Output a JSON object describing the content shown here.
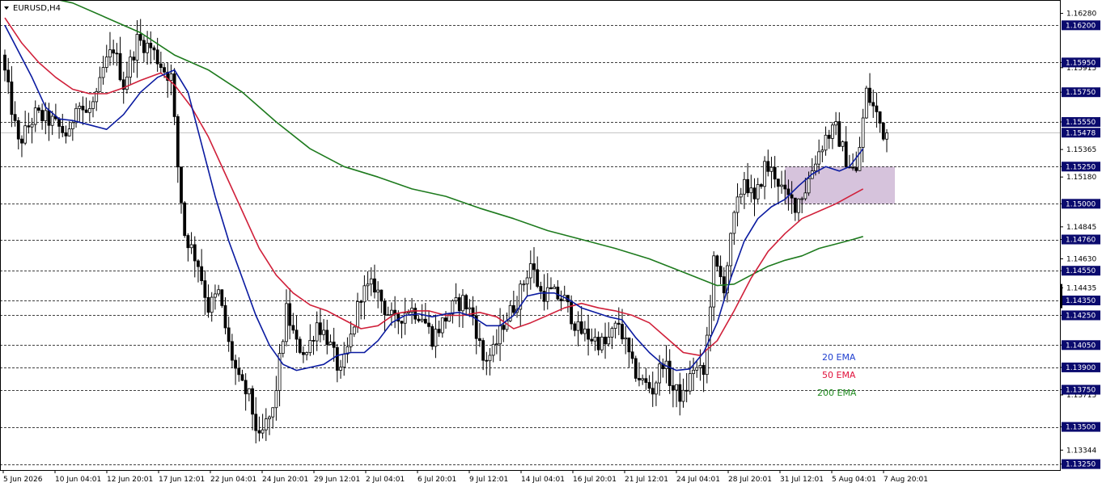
{
  "chart_data": {
    "type": "candlestick",
    "title": "EURUSD,H4",
    "symbol": "EURUSD",
    "timeframe": "H4",
    "ylim": [
      1.1321,
      1.1637
    ],
    "current_price": 1.15478,
    "y_ticks": [
      "1.16280",
      "1.15950",
      "1.15915",
      "1.15750",
      "1.15550",
      "1.15365",
      "1.15250",
      "1.15180",
      "1.15000",
      "1.14845",
      "1.14760",
      "1.14630",
      "1.14550",
      "1.14435",
      "1.14350",
      "1.14250",
      "1.14050",
      "1.13900",
      "1.13750",
      "1.13715",
      "1.13500",
      "1.13344",
      "1.13250"
    ],
    "level_lines": [
      1.162,
      1.1595,
      1.1575,
      1.1555,
      1.1525,
      1.15,
      1.1476,
      1.1455,
      1.1435,
      1.1425,
      1.1405,
      1.139,
      1.1375,
      1.135,
      1.1325
    ],
    "level_labels": [
      "1.16200",
      "1.15950",
      "1.15750",
      "1.15550",
      "1.15250",
      "1.15000",
      "1.14760",
      "1.14550",
      "1.14350",
      "1.14250",
      "1.14050",
      "1.13900",
      "1.13750",
      "1.13500",
      "1.13250"
    ],
    "current_price_label": "1.15478",
    "x_labels": [
      "5 Jun 2026",
      "10 Jun 04:01",
      "12 Jun 20:01",
      "17 Jun 12:01",
      "22 Jun 04:01",
      "24 Jun 20:01",
      "29 Jun 12:01",
      "2 Jul 04:01",
      "6 Jul 20:01",
      "9 Jul 12:01",
      "14 Jul 04:01",
      "16 Jul 20:01",
      "21 Jul 12:01",
      "24 Jul 04:01",
      "28 Jul 20:01",
      "31 Jul 12:01",
      "5 Aug 04:01",
      "7 Aug 20:01"
    ],
    "zone": {
      "from_price": 1.15,
      "to_price": 1.1525,
      "color": "#cfb8d6"
    },
    "ema_20": [
      [
        0,
        1.162
      ],
      [
        8,
        1.1585
      ],
      [
        12,
        1.1565
      ],
      [
        16,
        1.1557
      ],
      [
        20,
        1.1556
      ],
      [
        25,
        1.1553
      ],
      [
        30,
        1.155
      ],
      [
        35,
        1.156
      ],
      [
        40,
        1.1575
      ],
      [
        45,
        1.1585
      ],
      [
        50,
        1.159
      ],
      [
        54,
        1.1575
      ],
      [
        58,
        1.154
      ],
      [
        62,
        1.1505
      ],
      [
        66,
        1.1475
      ],
      [
        70,
        1.145
      ],
      [
        74,
        1.1425
      ],
      [
        78,
        1.1405
      ],
      [
        82,
        1.1392
      ],
      [
        86,
        1.1388
      ],
      [
        90,
        1.139
      ],
      [
        94,
        1.1392
      ],
      [
        98,
        1.1398
      ],
      [
        102,
        1.14
      ],
      [
        106,
        1.14
      ],
      [
        110,
        1.1408
      ],
      [
        114,
        1.142
      ],
      [
        118,
        1.1425
      ],
      [
        122,
        1.1426
      ],
      [
        126,
        1.1424
      ],
      [
        130,
        1.1426
      ],
      [
        134,
        1.1427
      ],
      [
        138,
        1.1424
      ],
      [
        142,
        1.1418
      ],
      [
        146,
        1.1418
      ],
      [
        150,
        1.1425
      ],
      [
        154,
        1.1438
      ],
      [
        158,
        1.144
      ],
      [
        162,
        1.144
      ],
      [
        166,
        1.1436
      ],
      [
        170,
        1.143
      ],
      [
        174,
        1.1427
      ],
      [
        178,
        1.1424
      ],
      [
        182,
        1.1422
      ],
      [
        186,
        1.141
      ],
      [
        190,
        1.14
      ],
      [
        194,
        1.1392
      ],
      [
        198,
        1.1388
      ],
      [
        202,
        1.1389
      ],
      [
        206,
        1.14
      ],
      [
        210,
        1.142
      ],
      [
        214,
        1.145
      ],
      [
        218,
        1.1475
      ],
      [
        222,
        1.149
      ],
      [
        226,
        1.1498
      ],
      [
        230,
        1.1503
      ],
      [
        234,
        1.1512
      ],
      [
        238,
        1.152
      ],
      [
        242,
        1.1525
      ],
      [
        246,
        1.1522
      ],
      [
        249,
        1.1525
      ],
      [
        253,
        1.1537
      ]
    ],
    "ema_50": [
      [
        0,
        1.1625
      ],
      [
        5,
        1.1608
      ],
      [
        10,
        1.1595
      ],
      [
        15,
        1.1585
      ],
      [
        20,
        1.1577
      ],
      [
        25,
        1.1574
      ],
      [
        30,
        1.1574
      ],
      [
        35,
        1.1578
      ],
      [
        40,
        1.1583
      ],
      [
        46,
        1.1588
      ],
      [
        50,
        1.158
      ],
      [
        55,
        1.1565
      ],
      [
        60,
        1.1545
      ],
      [
        65,
        1.152
      ],
      [
        70,
        1.1495
      ],
      [
        75,
        1.147
      ],
      [
        80,
        1.1452
      ],
      [
        85,
        1.144
      ],
      [
        90,
        1.1432
      ],
      [
        95,
        1.1428
      ],
      [
        100,
        1.1422
      ],
      [
        105,
        1.1416
      ],
      [
        110,
        1.1418
      ],
      [
        115,
        1.1426
      ],
      [
        120,
        1.1428
      ],
      [
        125,
        1.1428
      ],
      [
        130,
        1.1425
      ],
      [
        135,
        1.1425
      ],
      [
        140,
        1.1427
      ],
      [
        145,
        1.1424
      ],
      [
        150,
        1.1416
      ],
      [
        155,
        1.142
      ],
      [
        160,
        1.1425
      ],
      [
        165,
        1.143
      ],
      [
        170,
        1.1433
      ],
      [
        175,
        1.143
      ],
      [
        180,
        1.1428
      ],
      [
        185,
        1.1425
      ],
      [
        190,
        1.142
      ],
      [
        195,
        1.141
      ],
      [
        200,
        1.14
      ],
      [
        205,
        1.1398
      ],
      [
        210,
        1.1408
      ],
      [
        215,
        1.1428
      ],
      [
        220,
        1.145
      ],
      [
        225,
        1.1468
      ],
      [
        230,
        1.148
      ],
      [
        235,
        1.149
      ],
      [
        240,
        1.1495
      ],
      [
        245,
        1.15
      ],
      [
        249,
        1.1505
      ],
      [
        253,
        1.151
      ]
    ],
    "ema_200": [
      [
        0,
        1.165
      ],
      [
        10,
        1.164
      ],
      [
        20,
        1.1635
      ],
      [
        30,
        1.1625
      ],
      [
        40,
        1.1615
      ],
      [
        50,
        1.16
      ],
      [
        60,
        1.159
      ],
      [
        70,
        1.1575
      ],
      [
        80,
        1.1555
      ],
      [
        90,
        1.1537
      ],
      [
        100,
        1.1525
      ],
      [
        110,
        1.1518
      ],
      [
        120,
        1.151
      ],
      [
        130,
        1.1505
      ],
      [
        140,
        1.1497
      ],
      [
        150,
        1.149
      ],
      [
        160,
        1.1482
      ],
      [
        170,
        1.1476
      ],
      [
        180,
        1.147
      ],
      [
        190,
        1.1463
      ],
      [
        200,
        1.1454
      ],
      [
        210,
        1.1445
      ],
      [
        215,
        1.1446
      ],
      [
        220,
        1.1452
      ],
      [
        225,
        1.1458
      ],
      [
        230,
        1.1462
      ],
      [
        235,
        1.1465
      ],
      [
        240,
        1.147
      ],
      [
        245,
        1.1473
      ],
      [
        250,
        1.1476
      ],
      [
        253,
        1.1478
      ]
    ],
    "anchors": [
      [
        0,
        1.16
      ],
      [
        5,
        1.154
      ],
      [
        10,
        1.156
      ],
      [
        15,
        1.1555
      ],
      [
        20,
        1.1545
      ],
      [
        22,
        1.157
      ],
      [
        25,
        1.156
      ],
      [
        28,
        1.157
      ],
      [
        30,
        1.159
      ],
      [
        33,
        1.1605
      ],
      [
        36,
        1.158
      ],
      [
        40,
        1.161
      ],
      [
        44,
        1.1605
      ],
      [
        48,
        1.159
      ],
      [
        50,
        1.1585
      ],
      [
        52,
        1.1525
      ],
      [
        54,
        1.148
      ],
      [
        56,
        1.147
      ],
      [
        58,
        1.146
      ],
      [
        61,
        1.143
      ],
      [
        64,
        1.144
      ],
      [
        67,
        1.1405
      ],
      [
        70,
        1.138
      ],
      [
        73,
        1.137
      ],
      [
        76,
        1.134
      ],
      [
        78,
        1.1352
      ],
      [
        80,
        1.136
      ],
      [
        84,
        1.1428
      ],
      [
        87,
        1.1405
      ],
      [
        90,
        1.14
      ],
      [
        93,
        1.142
      ],
      [
        96,
        1.141
      ],
      [
        100,
        1.1385
      ],
      [
        103,
        1.141
      ],
      [
        106,
        1.144
      ],
      [
        110,
        1.1445
      ],
      [
        113,
        1.143
      ],
      [
        116,
        1.142
      ],
      [
        120,
        1.143
      ],
      [
        124,
        1.1425
      ],
      [
        127,
        1.141
      ],
      [
        130,
        1.142
      ],
      [
        133,
        1.143
      ],
      [
        136,
        1.1435
      ],
      [
        139,
        1.1425
      ],
      [
        142,
        1.1395
      ],
      [
        145,
        1.14
      ],
      [
        148,
        1.142
      ],
      [
        152,
        1.1435
      ],
      [
        156,
        1.146
      ],
      [
        159,
        1.144
      ],
      [
        162,
        1.144
      ],
      [
        166,
        1.1435
      ],
      [
        170,
        1.1415
      ],
      [
        174,
        1.141
      ],
      [
        178,
        1.1405
      ],
      [
        182,
        1.142
      ],
      [
        186,
        1.139
      ],
      [
        189,
        1.138
      ],
      [
        192,
        1.1375
      ],
      [
        195,
        1.1395
      ],
      [
        198,
        1.1375
      ],
      [
        201,
        1.137
      ],
      [
        204,
        1.139
      ],
      [
        207,
        1.1385
      ],
      [
        210,
        1.146
      ],
      [
        213,
        1.1445
      ],
      [
        216,
        1.149
      ],
      [
        219,
        1.1518
      ],
      [
        222,
        1.15
      ],
      [
        225,
        1.1525
      ],
      [
        228,
        1.152
      ],
      [
        231,
        1.1505
      ],
      [
        234,
        1.15
      ],
      [
        237,
        1.151
      ],
      [
        240,
        1.153
      ],
      [
        243,
        1.1545
      ],
      [
        246,
        1.155
      ],
      [
        249,
        1.153
      ],
      [
        252,
        1.152
      ],
      [
        255,
        1.1575
      ],
      [
        258,
        1.156
      ],
      [
        260,
        1.1548
      ]
    ],
    "legend": [
      {
        "name": "20 EMA",
        "color": "#1f3fcf"
      },
      {
        "name": "50 EMA",
        "color": "#e0103a"
      },
      {
        "name": "200 EMA",
        "color": "#1f8a1f"
      }
    ],
    "colors": {
      "ema_20": "#0a1aa0",
      "ema_50": "#d0203a",
      "ema_200": "#1d7a1d",
      "candles": "#000000",
      "grid": "#000000",
      "label_box": "#0a0a6e"
    }
  }
}
